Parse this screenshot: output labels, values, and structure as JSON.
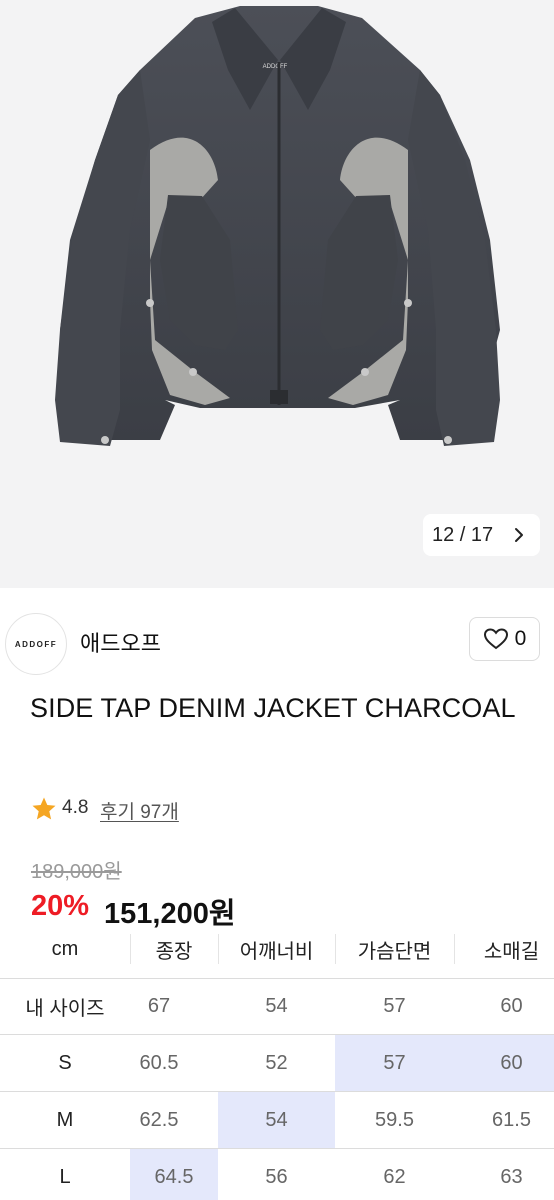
{
  "gallery": {
    "counter": "12 / 17",
    "image_label": "ADDOFF"
  },
  "brand": {
    "logo_text": "ADDOFF",
    "name": "애드오프"
  },
  "like": {
    "count": "0"
  },
  "product": {
    "title": "SIDE TAP DENIM JACKET CHARCOAL"
  },
  "rating": {
    "score": "4.8",
    "reviews_label": "후기 97개"
  },
  "price": {
    "original": "189,000원",
    "discount": "20%",
    "final": "151,200원"
  },
  "size_table": {
    "headers": [
      "cm",
      "종장",
      "어깨너비",
      "가슴단면",
      "소매길"
    ],
    "rows": [
      {
        "label": "내 사이즈",
        "values": [
          "67",
          "54",
          "57",
          "60"
        ]
      },
      {
        "label": "S",
        "values": [
          "60.5",
          "52",
          "57",
          "60"
        ]
      },
      {
        "label": "M",
        "values": [
          "62.5",
          "54",
          "59.5",
          "61.5"
        ]
      },
      {
        "label": "L",
        "values": [
          "64.5",
          "56",
          "62",
          "63"
        ]
      }
    ]
  },
  "colors": {
    "discount": "#ee1c25",
    "highlight": "#e4e8fb",
    "star": "#f5a623"
  }
}
